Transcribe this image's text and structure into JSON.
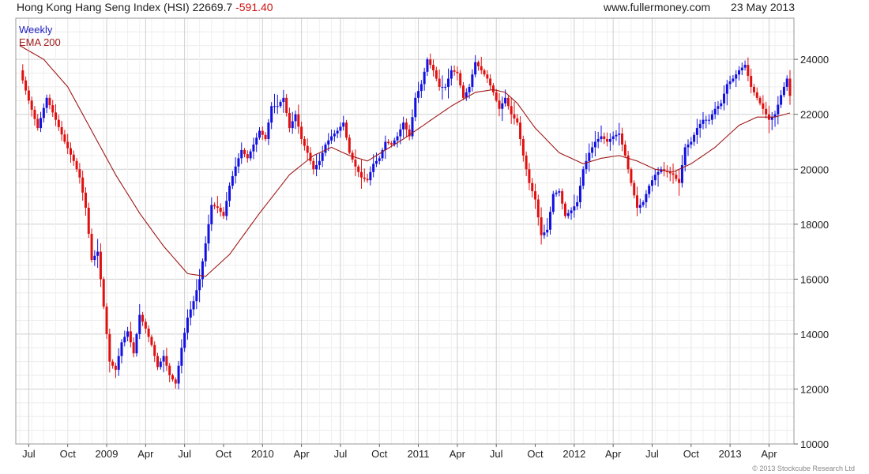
{
  "header": {
    "title": "Hong Kong Hang Seng Index (HSI)",
    "last": "22669.7",
    "change": "-591.40",
    "site": "www.fullermoney.com",
    "date": "23 May 2013"
  },
  "footer": {
    "copyright": "© 2013 Stockcube Research Ltd"
  },
  "colors": {
    "up": "#1010e0",
    "down": "#e01010",
    "ema": "#a01818",
    "grid": "#d8d8d8"
  },
  "chart_data": {
    "type": "candlestick",
    "series": [
      {
        "name": "Weekly",
        "anchors": [
          [
            0,
            23600
          ],
          [
            3,
            22500
          ],
          [
            6,
            21500
          ],
          [
            9,
            22600
          ],
          [
            12,
            21800
          ],
          [
            15,
            21000
          ],
          [
            18,
            20300
          ],
          [
            20,
            19700
          ],
          [
            22,
            18600
          ],
          [
            24,
            16700
          ],
          [
            26,
            17000
          ],
          [
            28,
            15000
          ],
          [
            30,
            13000
          ],
          [
            32,
            12700
          ],
          [
            34,
            13700
          ],
          [
            36,
            14100
          ],
          [
            38,
            13300
          ],
          [
            40,
            14700
          ],
          [
            42,
            14200
          ],
          [
            44,
            13600
          ],
          [
            46,
            12800
          ],
          [
            48,
            13200
          ],
          [
            50,
            12500
          ],
          [
            52,
            12200
          ],
          [
            54,
            13500
          ],
          [
            56,
            14600
          ],
          [
            58,
            15200
          ],
          [
            60,
            16000
          ],
          [
            62,
            17300
          ],
          [
            64,
            18700
          ],
          [
            66,
            18600
          ],
          [
            68,
            18300
          ],
          [
            70,
            19400
          ],
          [
            72,
            20100
          ],
          [
            74,
            20700
          ],
          [
            76,
            20400
          ],
          [
            78,
            20900
          ],
          [
            80,
            21400
          ],
          [
            82,
            21100
          ],
          [
            84,
            22300
          ],
          [
            86,
            22300
          ],
          [
            88,
            22600
          ],
          [
            90,
            21500
          ],
          [
            92,
            22000
          ],
          [
            94,
            21100
          ],
          [
            96,
            20600
          ],
          [
            98,
            20000
          ],
          [
            100,
            20300
          ],
          [
            102,
            20900
          ],
          [
            104,
            21200
          ],
          [
            106,
            21400
          ],
          [
            108,
            21700
          ],
          [
            110,
            20600
          ],
          [
            112,
            20100
          ],
          [
            114,
            19700
          ],
          [
            116,
            19600
          ],
          [
            118,
            20200
          ],
          [
            120,
            20400
          ],
          [
            122,
            21000
          ],
          [
            124,
            20900
          ],
          [
            126,
            21200
          ],
          [
            128,
            21700
          ],
          [
            130,
            21200
          ],
          [
            132,
            22600
          ],
          [
            134,
            23100
          ],
          [
            136,
            24000
          ],
          [
            138,
            23600
          ],
          [
            140,
            23000
          ],
          [
            142,
            23000
          ],
          [
            144,
            23600
          ],
          [
            146,
            23500
          ],
          [
            148,
            22600
          ],
          [
            150,
            23000
          ],
          [
            152,
            23900
          ],
          [
            154,
            23600
          ],
          [
            156,
            23300
          ],
          [
            158,
            22800
          ],
          [
            160,
            22200
          ],
          [
            162,
            22600
          ],
          [
            164,
            22000
          ],
          [
            166,
            21700
          ],
          [
            168,
            20500
          ],
          [
            170,
            19500
          ],
          [
            172,
            18900
          ],
          [
            174,
            17600
          ],
          [
            176,
            17800
          ],
          [
            178,
            19100
          ],
          [
            180,
            19200
          ],
          [
            182,
            18300
          ],
          [
            184,
            18500
          ],
          [
            186,
            18800
          ],
          [
            188,
            20000
          ],
          [
            190,
            20600
          ],
          [
            192,
            21000
          ],
          [
            194,
            21200
          ],
          [
            196,
            21000
          ],
          [
            198,
            21200
          ],
          [
            200,
            21300
          ],
          [
            202,
            20500
          ],
          [
            204,
            19500
          ],
          [
            206,
            18600
          ],
          [
            208,
            18800
          ],
          [
            210,
            19400
          ],
          [
            212,
            19800
          ],
          [
            214,
            20000
          ],
          [
            216,
            19900
          ],
          [
            218,
            19800
          ],
          [
            220,
            19500
          ],
          [
            222,
            20800
          ],
          [
            224,
            21000
          ],
          [
            226,
            21500
          ],
          [
            228,
            21800
          ],
          [
            230,
            21800
          ],
          [
            232,
            22200
          ],
          [
            234,
            22400
          ],
          [
            236,
            23100
          ],
          [
            238,
            23300
          ],
          [
            240,
            23600
          ],
          [
            242,
            23800
          ],
          [
            244,
            23000
          ],
          [
            246,
            22600
          ],
          [
            248,
            22200
          ],
          [
            250,
            21800
          ],
          [
            252,
            22000
          ],
          [
            254,
            22700
          ],
          [
            256,
            23300
          ],
          [
            257,
            22670
          ]
        ]
      },
      {
        "name": "EMA 200",
        "anchors": [
          [
            0,
            24500
          ],
          [
            8,
            24000
          ],
          [
            16,
            23000
          ],
          [
            24,
            21400
          ],
          [
            32,
            19800
          ],
          [
            40,
            18400
          ],
          [
            48,
            17200
          ],
          [
            56,
            16200
          ],
          [
            62,
            16100
          ],
          [
            70,
            16900
          ],
          [
            80,
            18400
          ],
          [
            90,
            19800
          ],
          [
            98,
            20500
          ],
          [
            104,
            20800
          ],
          [
            110,
            20500
          ],
          [
            116,
            20300
          ],
          [
            122,
            20700
          ],
          [
            128,
            21100
          ],
          [
            136,
            21700
          ],
          [
            144,
            22300
          ],
          [
            152,
            22800
          ],
          [
            158,
            22900
          ],
          [
            162,
            22800
          ],
          [
            166,
            22400
          ],
          [
            172,
            21500
          ],
          [
            180,
            20600
          ],
          [
            188,
            20200
          ],
          [
            194,
            20400
          ],
          [
            200,
            20500
          ],
          [
            206,
            20300
          ],
          [
            212,
            20000
          ],
          [
            218,
            19900
          ],
          [
            224,
            20200
          ],
          [
            232,
            20800
          ],
          [
            240,
            21600
          ],
          [
            246,
            21900
          ],
          [
            252,
            21900
          ],
          [
            257,
            22050
          ]
        ]
      }
    ],
    "yticks": [
      10000,
      12000,
      14000,
      16000,
      18000,
      20000,
      22000,
      24000
    ],
    "ylim": [
      10000,
      25500
    ],
    "xticks": [
      {
        "label": "Jul",
        "i": 3
      },
      {
        "label": "Oct",
        "i": 16
      },
      {
        "label": "2009",
        "i": 29
      },
      {
        "label": "Apr",
        "i": 42
      },
      {
        "label": "Jul",
        "i": 55
      },
      {
        "label": "Oct",
        "i": 68
      },
      {
        "label": "2010",
        "i": 81
      },
      {
        "label": "Apr",
        "i": 94
      },
      {
        "label": "Jul",
        "i": 107
      },
      {
        "label": "Oct",
        "i": 120
      },
      {
        "label": "2011",
        "i": 133
      },
      {
        "label": "Apr",
        "i": 146
      },
      {
        "label": "Jul",
        "i": 159
      },
      {
        "label": "Oct",
        "i": 172
      },
      {
        "label": "2012",
        "i": 185
      },
      {
        "label": "Apr",
        "i": 198
      },
      {
        "label": "Jul",
        "i": 211
      },
      {
        "label": "Oct",
        "i": 224
      },
      {
        "label": "2013",
        "i": 237
      },
      {
        "label": "Apr",
        "i": 250
      }
    ],
    "grid": true,
    "legend": "top-left"
  }
}
